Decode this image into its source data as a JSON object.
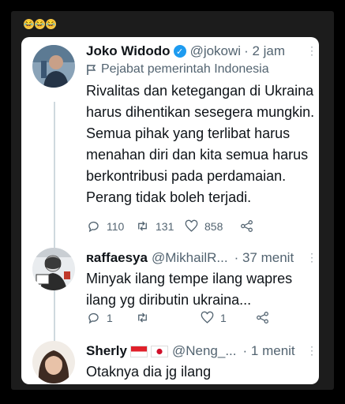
{
  "emojis": [
    "😂",
    "😂",
    "😂"
  ],
  "tweets": [
    {
      "display_name": "Joko Widodo",
      "handle": "@jokowi",
      "time": "· 2 jam",
      "label": "Pejabat pemerintah Indonesia",
      "text": "Rivalitas dan ketegangan di Ukraina harus dihentikan sesegera mungkin. Semua pihak yang terlibat harus menahan diri dan kita semua harus berkontribusi pada perdamaian. Perang tidak boleh terjadi.",
      "replies": "110",
      "retweets": "131",
      "likes": "858"
    },
    {
      "display_name": "ʀaffaesya",
      "handle": "@MikhailR...",
      "time": "· 37 menit",
      "text": "Minyak ilang tempe ilang wapres ilang yg diributin ukraina...",
      "replies": "1",
      "retweets": "",
      "likes": "1"
    },
    {
      "display_name": "Sherly",
      "handle": "@Neng_...",
      "time": "· 1 menit",
      "text": "Otaknya dia jg ilang"
    }
  ],
  "colors": {
    "background": "#000000",
    "frame": "#1c1c1c",
    "card": "#ffffff",
    "text": "#0f1419",
    "secondary": "#536471",
    "verified": "#1d9bf0"
  },
  "icons": [
    "reply-icon",
    "retweet-icon",
    "like-icon",
    "share-icon",
    "verified-badge-icon",
    "flag-label-icon",
    "more-icon"
  ]
}
